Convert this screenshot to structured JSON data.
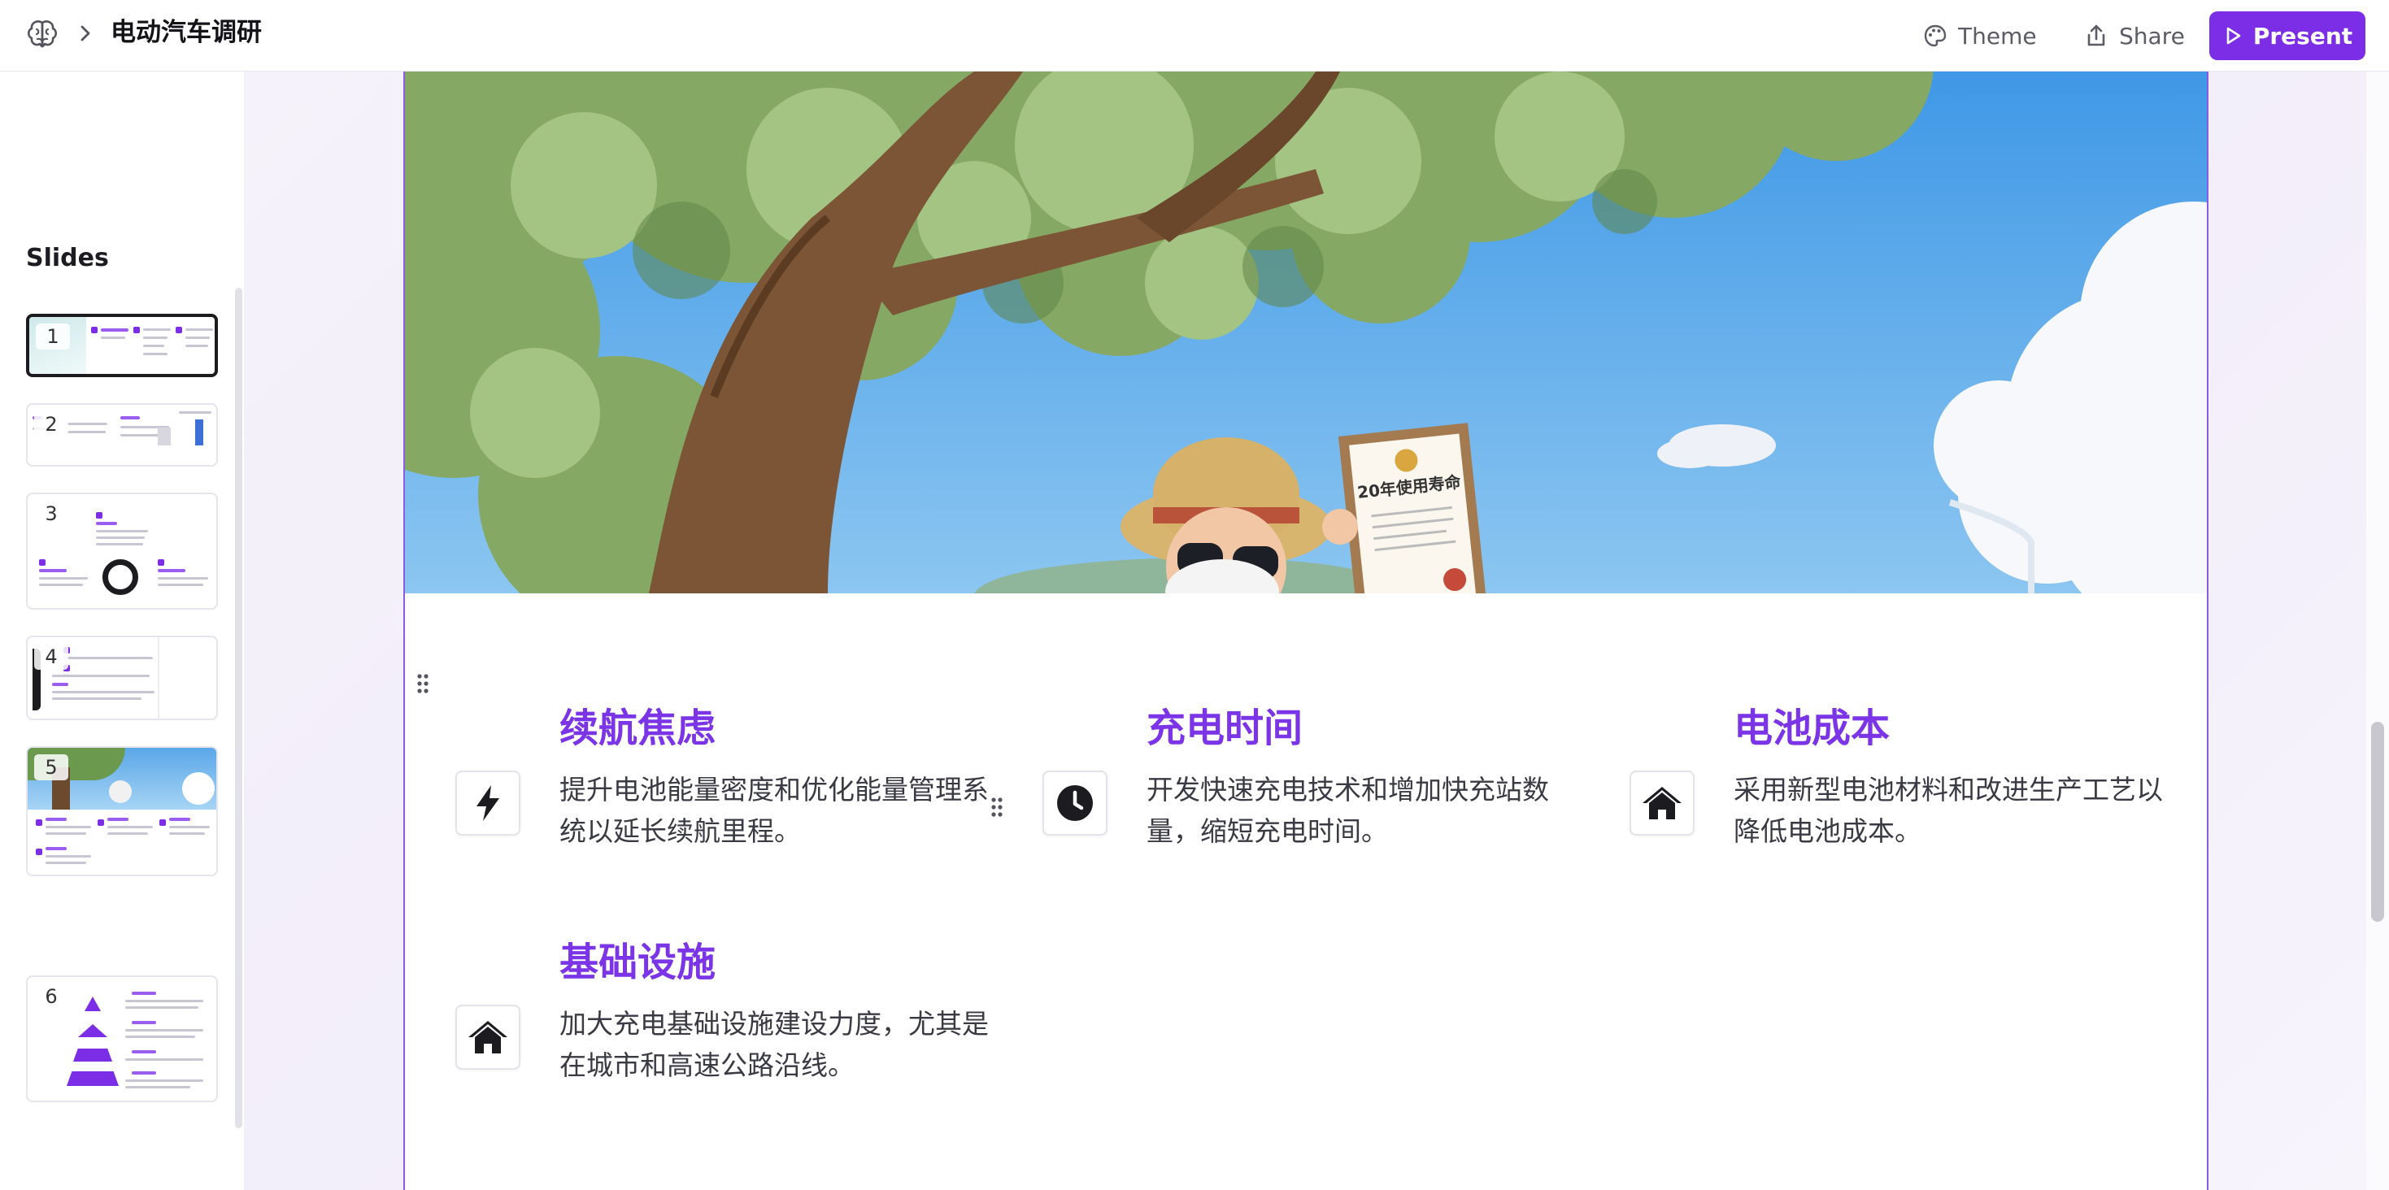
{
  "header": {
    "title": "电动汽车调研",
    "theme_label": "Theme",
    "share_label": "Share",
    "present_label": "Present"
  },
  "sidebar": {
    "title": "Slides",
    "slides": [
      {
        "number": "1"
      },
      {
        "number": "2"
      },
      {
        "number": "3"
      },
      {
        "number": "4"
      },
      {
        "number": "5"
      },
      {
        "number": "6"
      }
    ],
    "active_slide": "1"
  },
  "slide": {
    "hero_image": {
      "certificate_text": "20年使用寿命"
    },
    "features": [
      {
        "title": "续航焦虑",
        "description": "提升电池能量密度和优化能量管理系统以延长续航里程。",
        "icon": "lightning-bolt-icon"
      },
      {
        "title": "充电时间",
        "description": "开发快速充电技术和增加快充站数量，缩短充电时间。",
        "icon": "clock-icon"
      },
      {
        "title": "电池成本",
        "description": "采用新型电池材料和改进生产工艺以降低电池成本。",
        "icon": "home-icon"
      },
      {
        "title": "基础设施",
        "description": "加大充电基础设施建设力度，尤其是在城市和高速公路沿线。",
        "icon": "home-icon"
      }
    ]
  },
  "colors": {
    "accent": "#7c2ee6",
    "feature_title": "#7b35e6",
    "slide_border": "#8a5ce6"
  }
}
